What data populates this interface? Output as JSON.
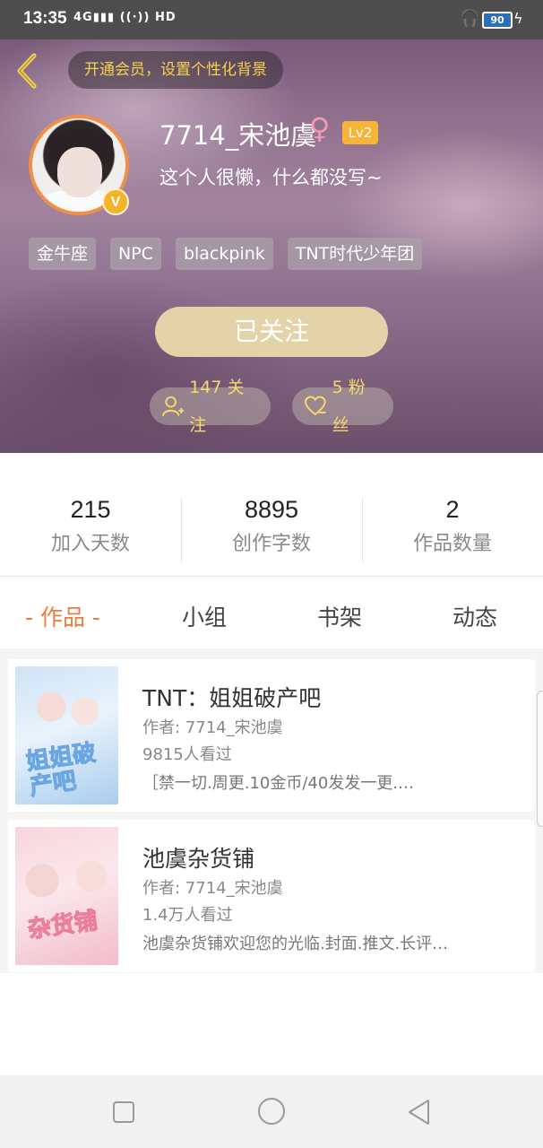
{
  "status_bar": {
    "time": "13:35",
    "signal": "4G",
    "wifi": "HD",
    "battery": "90"
  },
  "profile": {
    "vip_banner": "开通会员，设置个性化背景",
    "username": "7714_宋池虞",
    "gender_symbol": "♀",
    "level": "Lv2",
    "verified_badge": "V",
    "bio": "这个人很懒，什么都没写~",
    "tags": [
      "金牛座",
      "NPC",
      "blackpink",
      "TNT时代少年团"
    ],
    "follow_button": "已关注",
    "following": "147 关注",
    "fans": "5 粉丝"
  },
  "stats": [
    {
      "value": "215",
      "label": "加入天数"
    },
    {
      "value": "8895",
      "label": "创作字数"
    },
    {
      "value": "2",
      "label": "作品数量"
    }
  ],
  "tabs": [
    {
      "label": "- 作品 -",
      "active": true
    },
    {
      "label": "小组",
      "active": false
    },
    {
      "label": "书架",
      "active": false
    },
    {
      "label": "动态",
      "active": false
    }
  ],
  "works": [
    {
      "title": "TNT：姐姐破产吧",
      "author": "作者: 7714_宋池虞",
      "views": "9815人看过",
      "description": "［禁一切.周更.10金币/40发发一更.…",
      "cover_text": "姐姐破产吧"
    },
    {
      "title": "池虞杂货铺",
      "author": "作者: 7714_宋池虞",
      "views": "1.4万人看过",
      "description": "池虞杂货铺欢迎您的光临.封面.推文.长评…",
      "cover_text": "杂货铺"
    }
  ],
  "colors": {
    "accent": "#f07a3c",
    "vip_text": "#f6d24e",
    "follow_button": "#e3d3a8",
    "level_badge": "#f7b436"
  }
}
